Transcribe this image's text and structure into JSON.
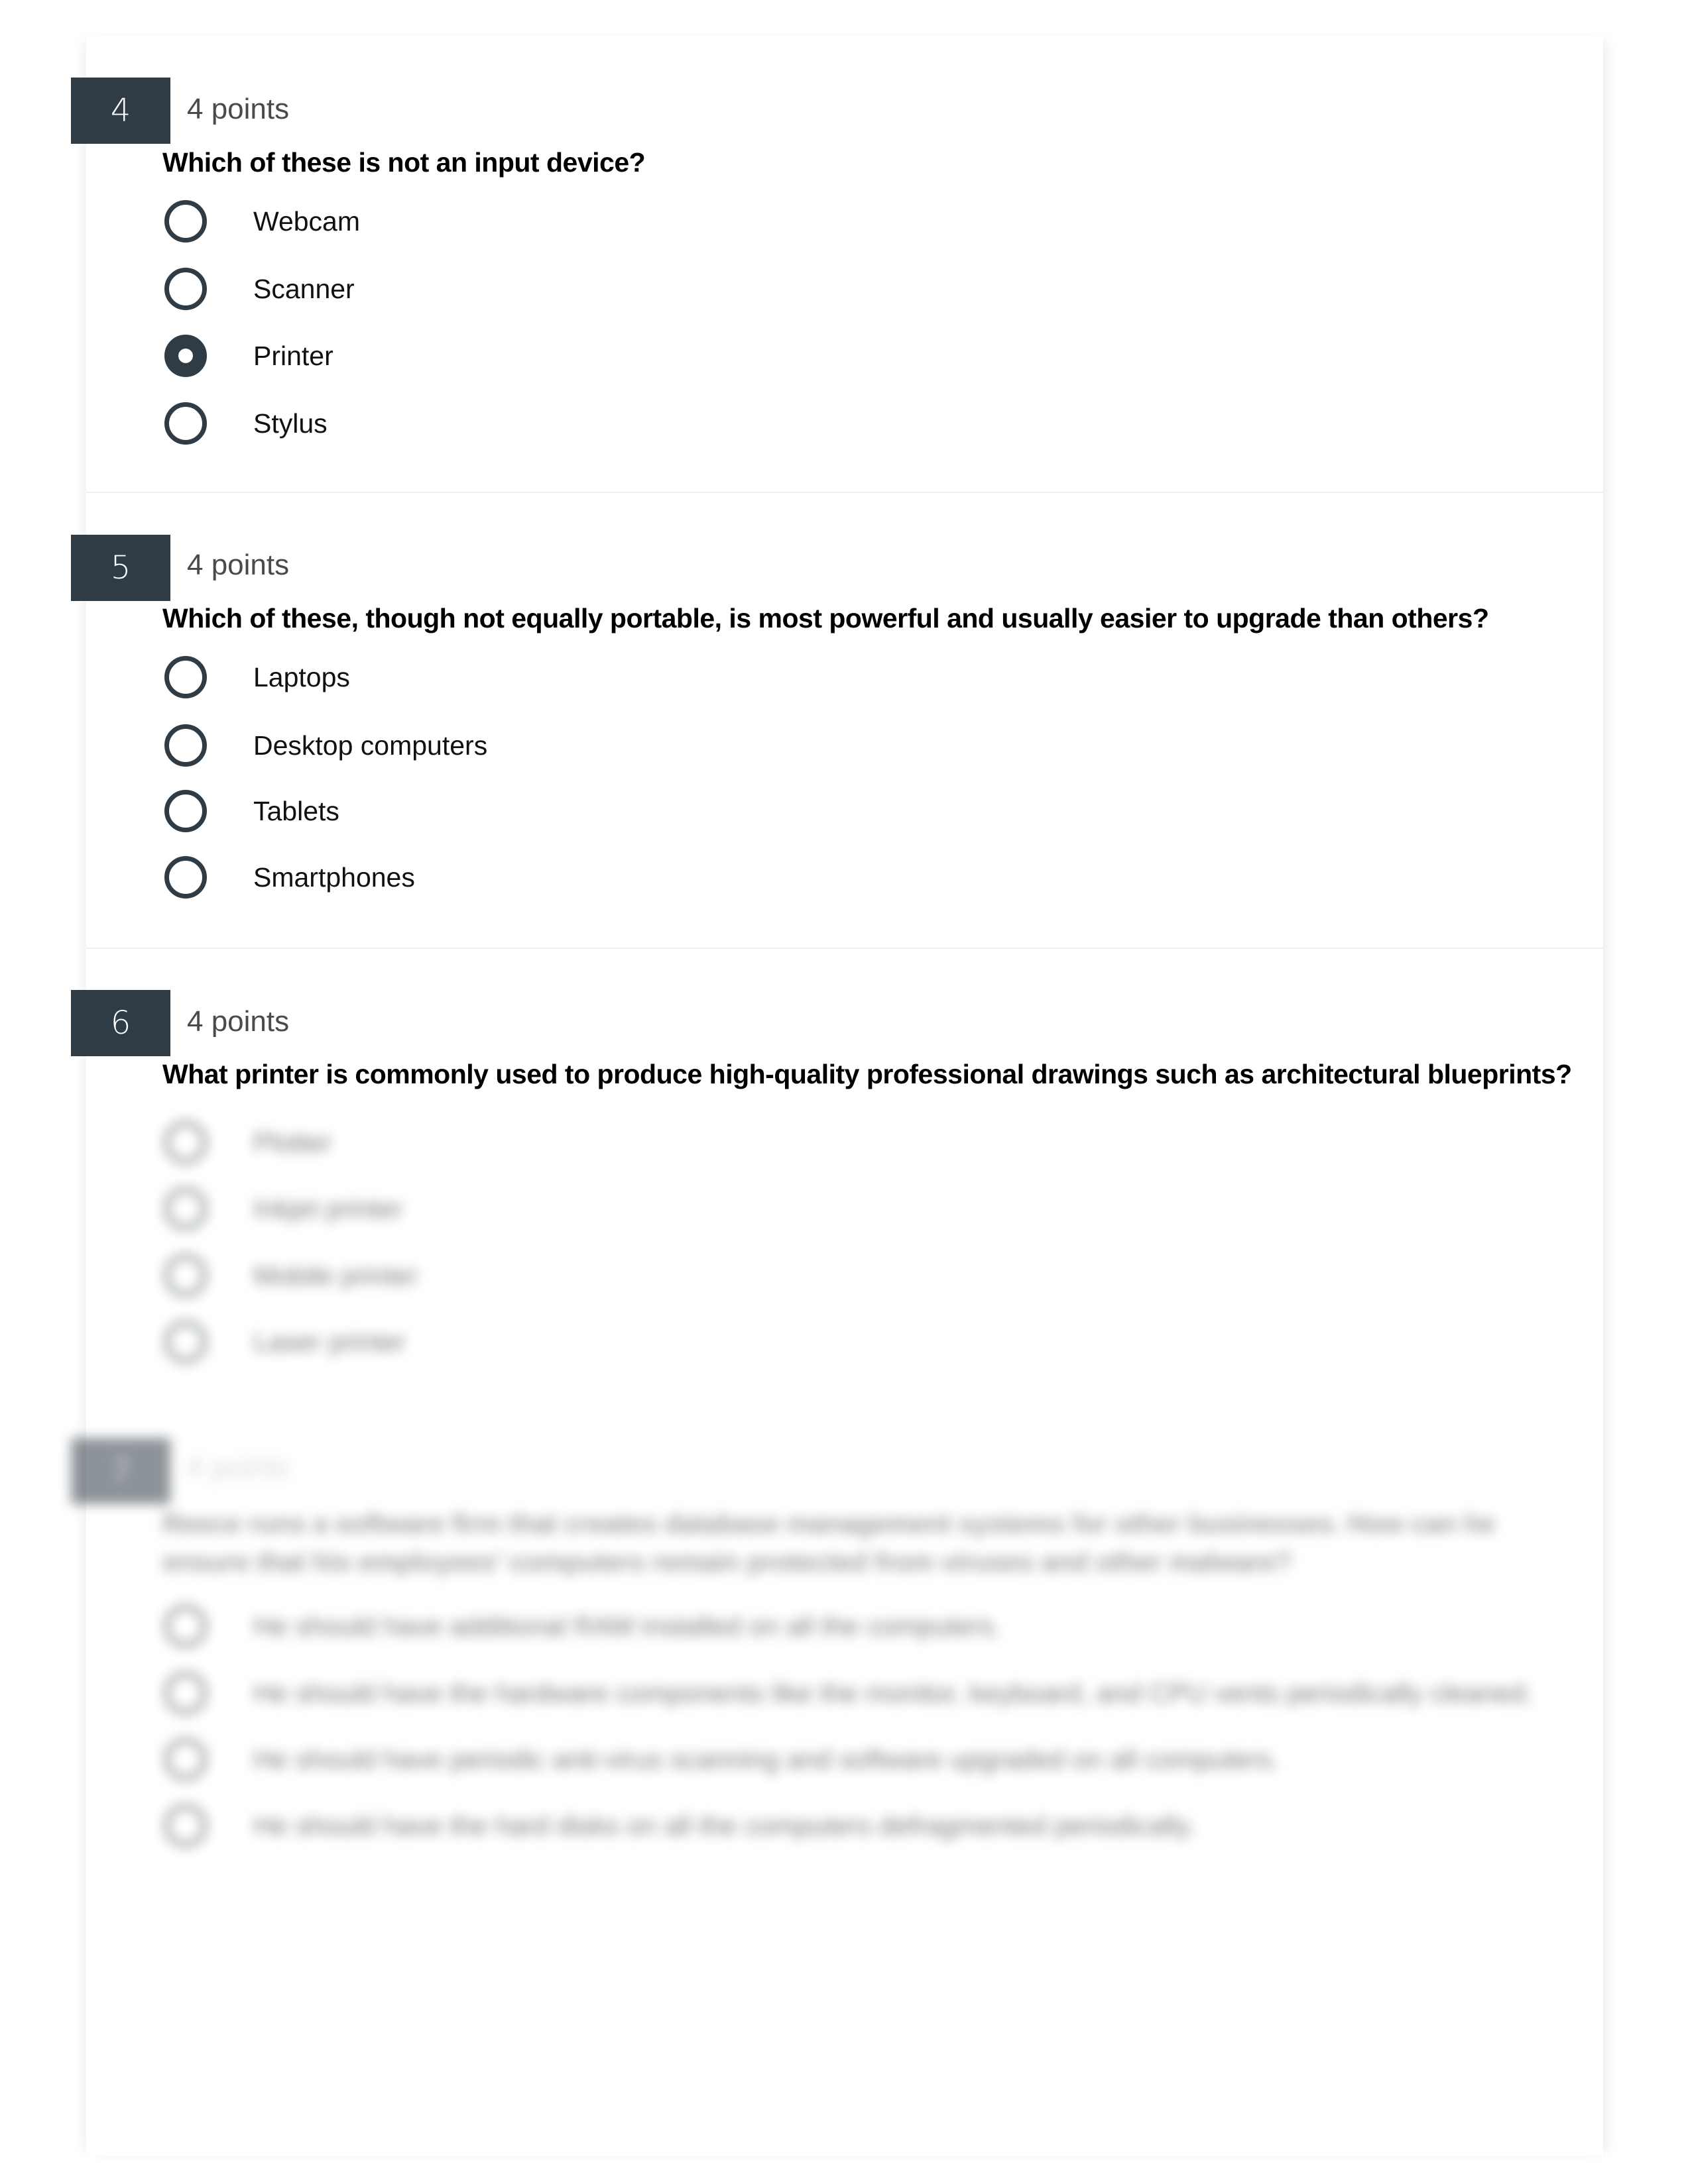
{
  "questions": [
    {
      "number": "4",
      "points": "4 points",
      "text": "Which of these is not an input device?",
      "options": [
        {
          "label": "Webcam",
          "selected": false
        },
        {
          "label": "Scanner",
          "selected": false
        },
        {
          "label": "Printer",
          "selected": true
        },
        {
          "label": "Stylus",
          "selected": false
        }
      ]
    },
    {
      "number": "5",
      "points": "4 points",
      "text": "Which of these, though not equally portable, is most powerful and usually easier to upgrade than others?",
      "options": [
        {
          "label": "Laptops",
          "selected": false
        },
        {
          "label": "Desktop computers",
          "selected": false
        },
        {
          "label": "Tablets",
          "selected": false
        },
        {
          "label": "Smartphones",
          "selected": false
        }
      ]
    },
    {
      "number": "6",
      "points": "4 points",
      "text": "What printer is commonly used to produce high-quality professional drawings such as architectural blueprints?",
      "options_blurred": true,
      "options": [
        {
          "label": "Plotter",
          "selected": false
        },
        {
          "label": "Inkjet printer",
          "selected": false
        },
        {
          "label": "Mobile printer",
          "selected": false
        },
        {
          "label": "Laser printer",
          "selected": false
        }
      ]
    },
    {
      "number": "7",
      "points": "4 points",
      "blurred": true,
      "text": "Reece runs a software firm that creates database management systems for other businesses. How can he ensure that his employees' computers remain protected from viruses and other malware?",
      "options": [
        {
          "label": "He should have additional RAM installed on all the computers.",
          "selected": false
        },
        {
          "label": "He should have the hardware components like the monitor, keyboard, and CPU vents periodically cleaned.",
          "selected": false
        },
        {
          "label": "He should have periodic anti-virus scanning and software upgraded on all computers.",
          "selected": false
        },
        {
          "label": "He should have the hard disks on all the computers defragmented periodically.",
          "selected": false
        }
      ]
    }
  ],
  "colors": {
    "badge": "#2f3b45",
    "radio": "#2f3b45",
    "points_text": "#4a4a4a"
  }
}
